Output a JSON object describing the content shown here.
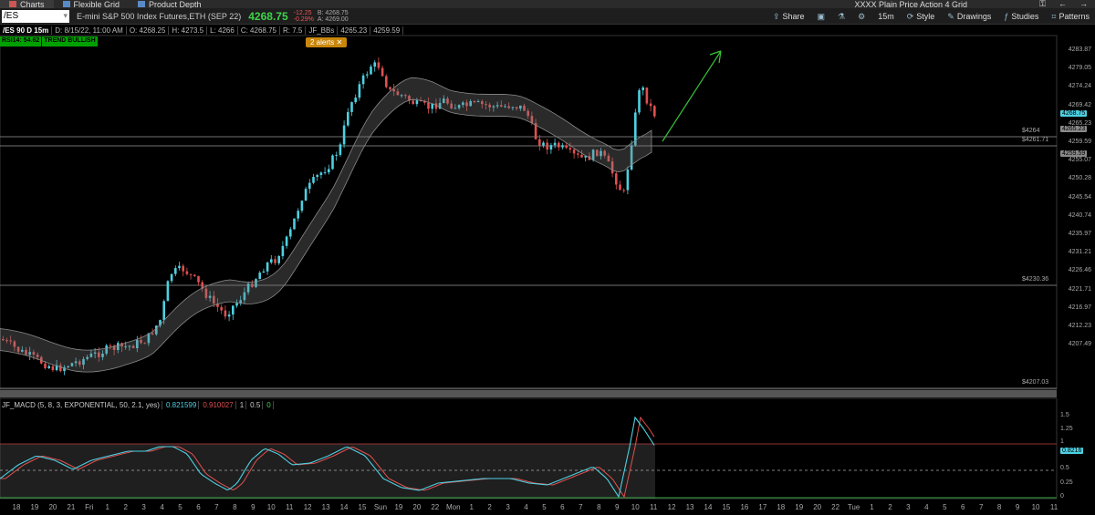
{
  "window": {
    "tabs": [
      {
        "label": "Charts",
        "icon": "chart-icon"
      },
      {
        "label": "Flexible Grid",
        "icon": "grid-icon"
      },
      {
        "label": "Product Depth",
        "icon": "depth-icon"
      }
    ],
    "grid_title": "XXXX Plain Price Action  4 Grid"
  },
  "toolbar": {
    "symbol": "/ES",
    "description": "E-mini S&P 500 Index Futures,ETH (SEP 22)",
    "last_price": "4268.75",
    "change": "-12.25",
    "change_pct": "-0.29%",
    "bid": "B: 4268.75",
    "ask": "A: 4269.00",
    "share": "Share",
    "timeframe": "15m",
    "style": "Style",
    "drawings": "Drawings",
    "studies": "Studies",
    "patterns": "Patterns"
  },
  "info": {
    "symbol_period": "/ES 90 D 15m",
    "date": "D: 8/15/22, 11:00 AM",
    "open": "O: 4268.25",
    "high": "H: 4273.5",
    "low": "L: 4266",
    "close": "C: 4268.75",
    "range": "R: 7.5",
    "study": "JF_BBs",
    "bb1": "4265.23",
    "bb2": "4259.59"
  },
  "badges": {
    "rsi": "RSI14: 54.62",
    "trend": "TREND BULLISH",
    "alerts": "2 alerts ✕"
  },
  "price_axis": [
    "4283.87",
    "4279.05",
    "4274.24",
    "4269.42",
    "4265.23",
    "4259.59",
    "4255.07",
    "4250.28",
    "4245.54",
    "4240.74",
    "4235.97",
    "4231.21",
    "4226.46",
    "4221.71",
    "4216.97",
    "4212.23",
    "4207.49"
  ],
  "price_tags": {
    "last": "4268.75",
    "bb_upper": "4265.23",
    "bb_lower": "4259.59"
  },
  "horizontal_lines": [
    {
      "label": "$4264"
    },
    {
      "label": "$4261.71"
    },
    {
      "label": "$4230.36"
    },
    {
      "label": "$4207.03"
    }
  ],
  "macd": {
    "name": "JF_MACD (5, 8, 3, EXPONENTIAL, 50, 2.1, yes)",
    "v1": "0.821599",
    "v2": "0.910027",
    "v3": "1",
    "v4": "0.5",
    "v5": "0",
    "axis": [
      "1.5",
      "1.25",
      "1",
      "0.8216",
      "0.5",
      "0.25",
      "0"
    ]
  },
  "time_axis": [
    "18",
    "19",
    "20",
    "21",
    "Fri",
    "1",
    "2",
    "3",
    "4",
    "5",
    "6",
    "7",
    "8",
    "9",
    "10",
    "11",
    "12",
    "13",
    "14",
    "15",
    "Sun",
    "19",
    "20",
    "22",
    "Mon",
    "1",
    "2",
    "3",
    "4",
    "5",
    "6",
    "7",
    "8",
    "9",
    "10",
    "11",
    "12",
    "13",
    "14",
    "15",
    "16",
    "17",
    "18",
    "19",
    "20",
    "22",
    "Tue",
    "1",
    "2",
    "3",
    "4",
    "5",
    "6",
    "7",
    "8",
    "9",
    "10",
    "11"
  ],
  "colors": {
    "up": "#4dd0e1",
    "down": "#e05050",
    "bb_band": "#8a8a8a",
    "arrow": "#39c43a",
    "price_tag": "#4dd0e1"
  }
}
